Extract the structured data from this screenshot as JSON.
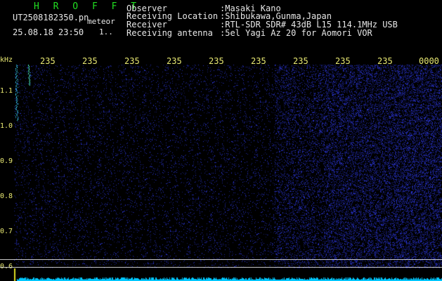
{
  "header": {
    "title": "H R O F F T",
    "filename": "UT2508182350.pn",
    "mode": "meteor",
    "datetime": "25.08.18 23:50",
    "status": "1..",
    "rows": [
      {
        "label": "Observer",
        "value": ":Masaki Kano"
      },
      {
        "label": "Receiving Location",
        "value": ":Shibukawa,Gunma,Japan"
      },
      {
        "label": "Receiver",
        "value": ":RTL-SDR SDR# 43dB L15 114.1MHz USB"
      },
      {
        "label": "Receiving antenna",
        "value": ":5el Yagi Az 20 for Aomori VOR"
      }
    ]
  },
  "axis": {
    "unit": "kHz",
    "x_ticks": [
      "235",
      "235",
      "235",
      "235",
      "235",
      "235",
      "235",
      "235",
      "235",
      "0000"
    ],
    "y_ticks": [
      "1.1",
      "1.0",
      "0.9",
      "0.8",
      "0.7",
      "0.6"
    ]
  },
  "colors": {
    "background": "#000000",
    "title": "#22dd22",
    "label": "#e8e872",
    "noise": "#2a34a8",
    "signal": "#00c0ff"
  }
}
